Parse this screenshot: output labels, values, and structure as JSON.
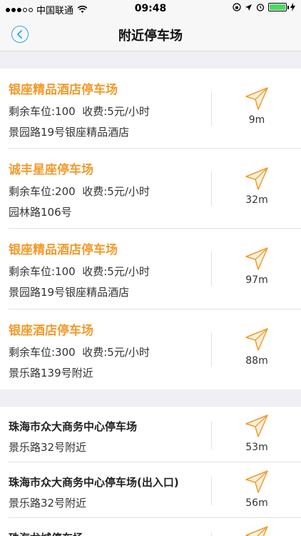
{
  "status": {
    "carrier": "中国联通",
    "time": "09:48"
  },
  "nav": {
    "title": "附近停车场"
  },
  "colors": {
    "accent": "#f39a2b",
    "back": "#2fa3e6",
    "battery": "#4cd964"
  },
  "section1": [
    {
      "name": "银座精品酒店停车场",
      "spaces": "剩余车位:100",
      "fee": "收费:5元/小时",
      "address": "景园路19号银座精品酒店",
      "distance": "9m"
    },
    {
      "name": "诚丰星座停车场",
      "spaces": "剩余车位:200",
      "fee": "收费:5元/小时",
      "address": "园林路106号",
      "distance": "32m"
    },
    {
      "name": "银座精品酒店停车场",
      "spaces": "剩余车位:100",
      "fee": "收费:5元/小时",
      "address": "景园路19号银座精品酒店",
      "distance": "97m"
    },
    {
      "name": "银座酒店停车场",
      "spaces": "剩余车位:300",
      "fee": "收费:5元/小时",
      "address": "景乐路139号附近",
      "distance": "88m"
    }
  ],
  "section2": [
    {
      "name": "珠海市众大商务中心停车场",
      "address": "景乐路32号附近",
      "distance": "53m"
    },
    {
      "name": "珠海市众大商务中心停车场(出入口)",
      "address": "景乐路32号附近",
      "distance": "56m"
    },
    {
      "name": "珠海龙城停车场",
      "address": "",
      "distance": ""
    }
  ]
}
